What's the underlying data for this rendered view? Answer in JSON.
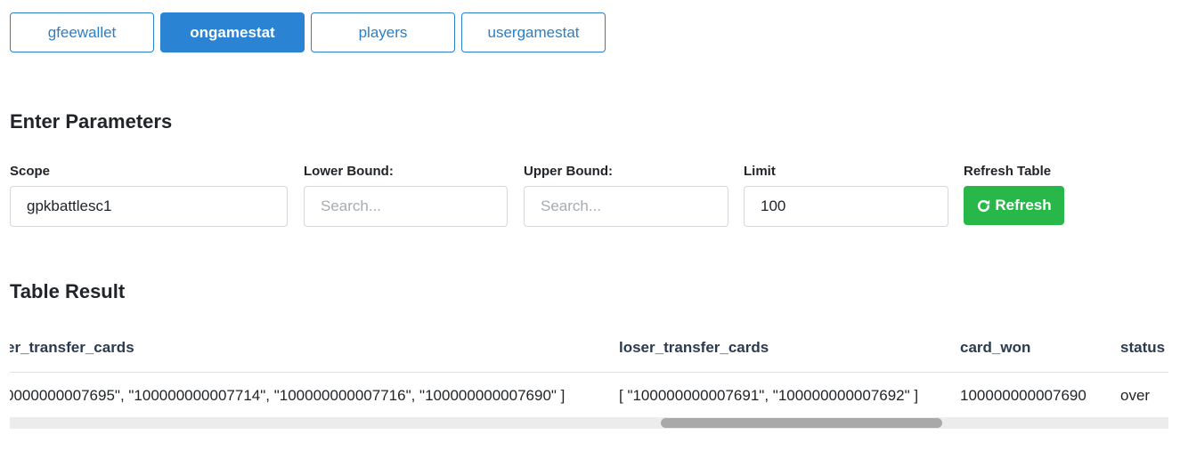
{
  "tabs": [
    {
      "label": "gfeewallet",
      "active": false
    },
    {
      "label": "ongamestat",
      "active": true
    },
    {
      "label": "players",
      "active": false
    },
    {
      "label": "usergamestat",
      "active": false
    }
  ],
  "params": {
    "heading": "Enter Parameters",
    "scope": {
      "label": "Scope",
      "value": "gpkbattlesc1"
    },
    "lower_bound": {
      "label": "Lower Bound:",
      "placeholder": "Search..."
    },
    "upper_bound": {
      "label": "Upper Bound:",
      "placeholder": "Search..."
    },
    "limit": {
      "label": "Limit",
      "value": "100"
    },
    "refresh": {
      "label": "Refresh Table",
      "button": "Refresh",
      "icon": "refresh-icon"
    }
  },
  "result": {
    "heading": "Table Result",
    "columns": [
      "er_transfer_cards",
      "loser_transfer_cards",
      "card_won",
      "status"
    ],
    "rows": [
      [
        "0000000007695\", \"100000000007714\", \"100000000007716\", \"100000000007690\" ]",
        "[ \"100000000007691\", \"100000000007692\" ]",
        "100000000007690",
        "over"
      ]
    ]
  },
  "colors": {
    "primary": "#2a83d3",
    "success": "#28b84a"
  }
}
